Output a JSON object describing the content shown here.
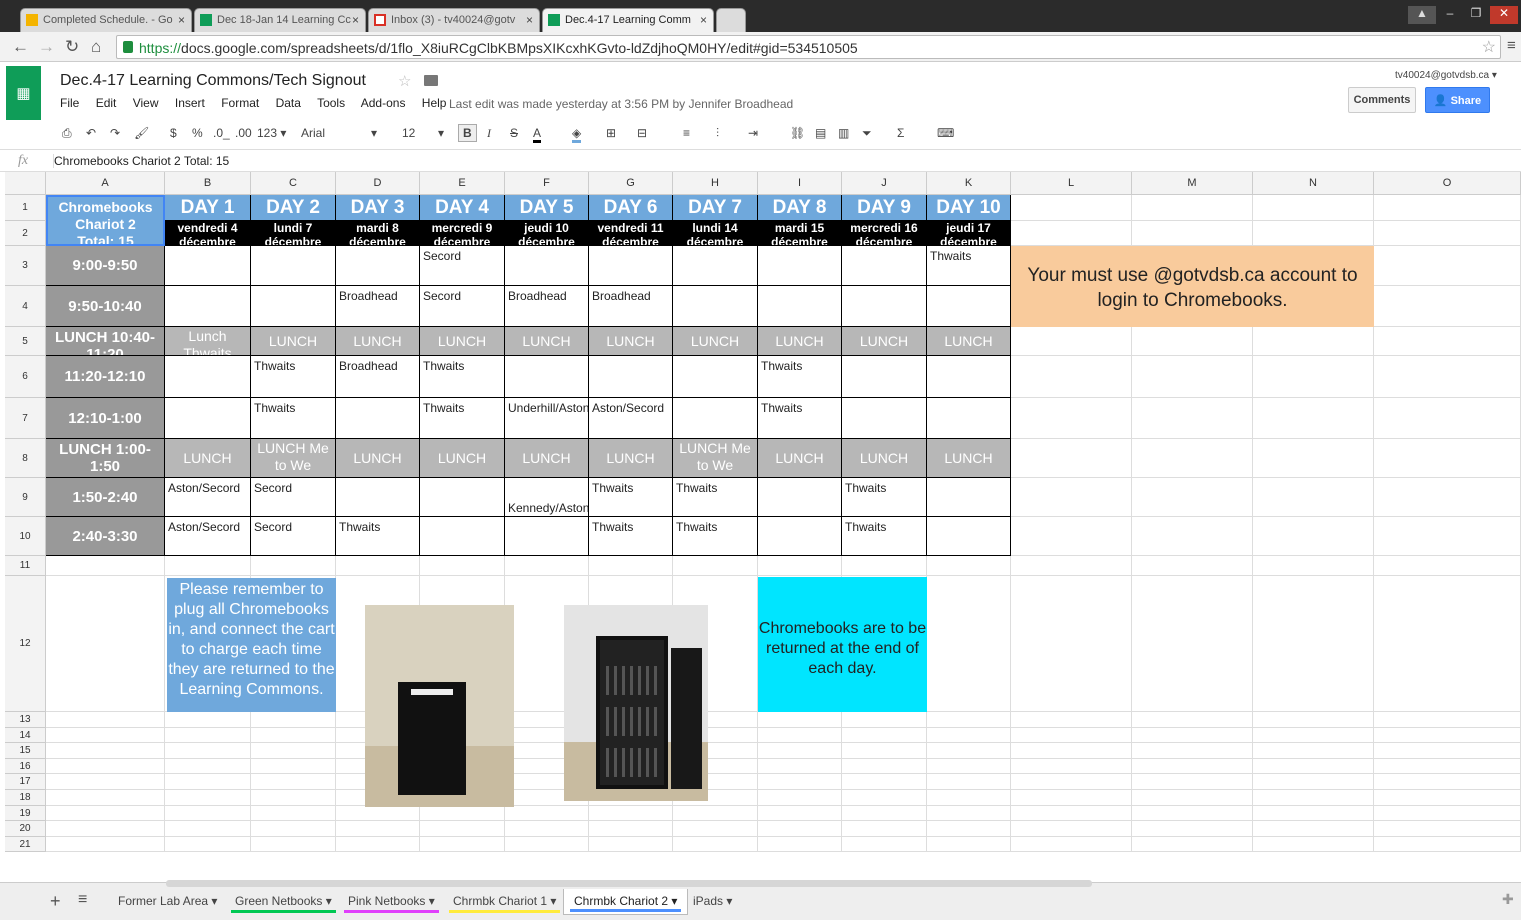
{
  "browser": {
    "tabs": [
      {
        "label": "Completed Schedule. - Go",
        "icon": "drive-icon"
      },
      {
        "label": "Dec 18-Jan 14 Learning Cc",
        "icon": "sheets-icon"
      },
      {
        "label": "Inbox (3) - tv40024@gotv",
        "icon": "gmail-icon"
      },
      {
        "label": "Dec.4-17 Learning Comm",
        "icon": "sheets-icon",
        "active": true
      }
    ],
    "url_scheme": "https://",
    "url_rest": "docs.google.com/spreadsheets/d/1flo_X8iuRCgClbKBMpsXIKcxhKGvto-ldZdjhoQM0HY/edit#gid=534510505"
  },
  "doc": {
    "title": "Dec.4-17 Learning Commons/Tech Signout",
    "menu": [
      "File",
      "Edit",
      "View",
      "Insert",
      "Format",
      "Data",
      "Tools",
      "Add-ons",
      "Help"
    ],
    "last_edit": "Last edit was made yesterday at 3:56 PM by Jennifer Broadhead",
    "account": "tv40024@gotvdsb.ca",
    "comments_label": "Comments",
    "share_label": "Share"
  },
  "toolbar": {
    "currency": "$",
    "percent": "%",
    "dec_less": ".0_",
    "dec_more": ".00",
    "more_formats": "123",
    "font": "Arial",
    "size": "12",
    "bold": "B",
    "italic": "I",
    "strike": "S",
    "text_color": "A"
  },
  "formula_bar": {
    "fx": "fx",
    "value": "Chromebooks Chariot 2  Total: 15"
  },
  "columns": [
    "A",
    "B",
    "C",
    "D",
    "E",
    "F",
    "G",
    "H",
    "I",
    "J",
    "K",
    "L",
    "M",
    "N",
    "O"
  ],
  "rows": [
    "1",
    "2",
    "3",
    "4",
    "5",
    "6",
    "7",
    "8",
    "9",
    "10",
    "11",
    "12",
    "13",
    "14",
    "15",
    "16",
    "17",
    "18",
    "19",
    "20",
    "21"
  ],
  "corner": {
    "line1": "Chromebooks",
    "line2": "Chariot 2",
    "line3": "Total: 15"
  },
  "days": [
    {
      "label": "DAY 1",
      "weekday": "vendredi 4",
      "month": "décembre"
    },
    {
      "label": "DAY 2",
      "weekday": "lundi 7",
      "month": "décembre"
    },
    {
      "label": "DAY 3",
      "weekday": "mardi 8",
      "month": "décembre"
    },
    {
      "label": "DAY 4",
      "weekday": "mercredi 9",
      "month": "décembre"
    },
    {
      "label": "DAY 5",
      "weekday": "jeudi 10",
      "month": "décembre"
    },
    {
      "label": "DAY 6",
      "weekday": "vendredi 11",
      "month": "décembre"
    },
    {
      "label": "DAY 7",
      "weekday": "lundi 14",
      "month": "décembre"
    },
    {
      "label": "DAY 8",
      "weekday": "mardi 15",
      "month": "décembre"
    },
    {
      "label": "DAY 9",
      "weekday": "mercredi 16",
      "month": "décembre"
    },
    {
      "label": "DAY 10",
      "weekday": "jeudi 17",
      "month": "décembre"
    }
  ],
  "periods": [
    {
      "time": "9:00-9:50",
      "lunch": false,
      "cells": [
        "",
        "",
        "",
        "Secord",
        "",
        "",
        "",
        "",
        "",
        "Thwaits"
      ]
    },
    {
      "time": "9:50-10:40",
      "lunch": false,
      "cells": [
        "",
        "",
        "Broadhead",
        "Secord",
        "Broadhead",
        "Broadhead",
        "",
        "",
        "",
        ""
      ]
    },
    {
      "time": "LUNCH 10:40-11:20",
      "lunch": true,
      "cells": [
        "Lunch Thwaits",
        "LUNCH",
        "LUNCH",
        "LUNCH",
        "LUNCH",
        "LUNCH",
        "LUNCH",
        "LUNCH",
        "LUNCH",
        "LUNCH"
      ]
    },
    {
      "time": "11:20-12:10",
      "lunch": false,
      "cells": [
        "",
        "Thwaits",
        "Broadhead",
        "Thwaits",
        "",
        "",
        "",
        "Thwaits",
        "",
        ""
      ]
    },
    {
      "time": "12:10-1:00",
      "lunch": false,
      "cells": [
        "",
        "Thwaits",
        "",
        "Thwaits",
        "Underhill/Aston",
        "Aston/Secord",
        "",
        "Thwaits",
        "",
        ""
      ]
    },
    {
      "time": "LUNCH 1:00-1:50",
      "lunch": true,
      "cells": [
        "LUNCH",
        "LUNCH Me to We Thwaits",
        "LUNCH",
        "LUNCH",
        "LUNCH",
        "LUNCH",
        "LUNCH Me to We Thwaits",
        "LUNCH",
        "LUNCH",
        "LUNCH"
      ]
    },
    {
      "time": "1:50-2:40",
      "lunch": false,
      "cells": [
        "Aston/Secord",
        "Secord",
        "",
        "",
        "Kennedy/Aston",
        "Thwaits",
        "Thwaits",
        "",
        "Thwaits",
        ""
      ]
    },
    {
      "time": "2:40-3:30",
      "lunch": false,
      "cells": [
        "Aston/Secord",
        "Secord",
        "Thwaits",
        "",
        "",
        "Thwaits",
        "Thwaits",
        "",
        "Thwaits",
        ""
      ]
    }
  ],
  "notes": {
    "orange": "Your must use @gotvdsb.ca account to login to Chromebooks.",
    "blue": "Please remember to plug all Chromebooks in, and connect the cart to charge each time they are returned to the Learning Commons.",
    "cyan": "Chromebooks are to be returned at the end of each day."
  },
  "sheet_tabs": [
    {
      "label": "Former Lab Area",
      "color": ""
    },
    {
      "label": "Green Netbooks",
      "color": "#00c853"
    },
    {
      "label": "Pink Netbooks",
      "color": "#e040fb"
    },
    {
      "label": "Chrmbk Chariot 1",
      "color": "#ffeb3b"
    },
    {
      "label": "Chrmbk Chariot 2",
      "color": "#4d90fe",
      "active": true
    },
    {
      "label": "iPads",
      "color": ""
    }
  ],
  "colors": {
    "day_header": "#6fa8dc",
    "time_header": "#999999",
    "lunch": "#b7b7b7",
    "orange_note": "#f9cb9c",
    "cyan_note": "#00e5ff",
    "sheets_green": "#0f9d58"
  }
}
